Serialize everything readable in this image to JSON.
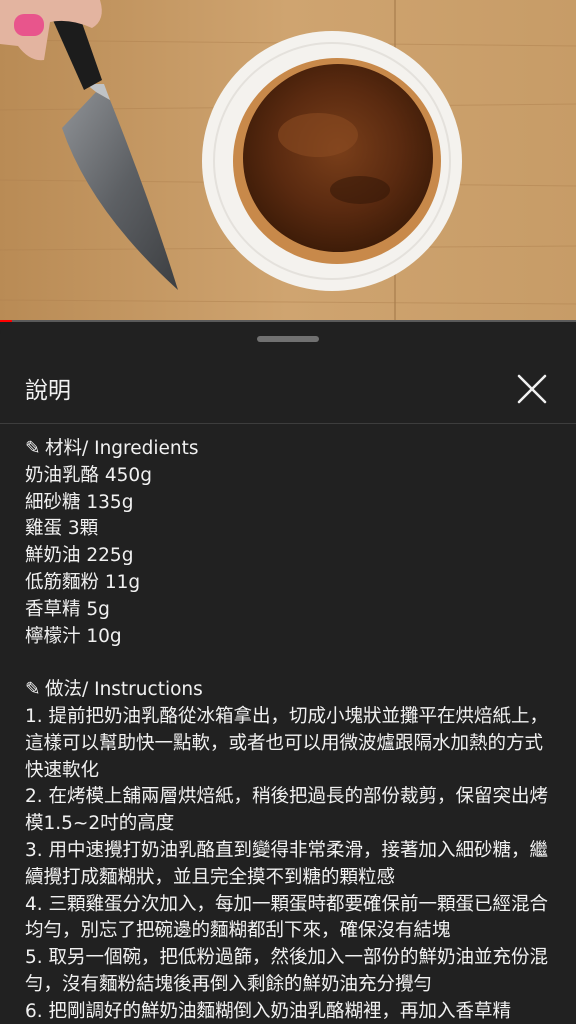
{
  "video": {
    "progress_fraction": 0.02,
    "accent_color": "#ff0000"
  },
  "sheet": {
    "title": "說明",
    "close_icon": "close-icon"
  },
  "description": {
    "ingredients_heading_icon": "pencil-icon",
    "ingredients_heading": "材料/ Ingredients",
    "ingredients": [
      "奶油乳酪 450g",
      "細砂糖 135g",
      "雞蛋 3顆",
      "鮮奶油 225g",
      "低筋麵粉 11g",
      "香草精 5g",
      "檸檬汁 10g"
    ],
    "instructions_heading_icon": "pencil-icon",
    "instructions_heading": "做法/ Instructions",
    "steps": [
      "1. 提前把奶油乳酪從冰箱拿出，切成小塊狀並攤平在烘焙紙上，這樣可以幫助快一點軟，或者也可以用微波爐跟隔水加熱的方式快速軟化",
      "2. 在烤模上舖兩層烘焙紙，稍後把過長的部份裁剪，保留突出烤模1.5~2吋的高度",
      "3. 用中速攪打奶油乳酪直到變得非常柔滑，接著加入細砂糖，繼續攪打成麵糊狀，並且完全摸不到糖的顆粒感",
      "4. 三顆雞蛋分次加入，每加一顆蛋時都要確保前一顆蛋已經混合均勻，別忘了把碗邊的麵糊都刮下來，確保沒有結塊",
      "5. 取另一個碗，把低粉過篩，然後加入一部份的鮮奶油並充份混勻，沒有麵粉結塊後再倒入剩餘的鮮奶油充分攪勻",
      "6. 把剛調好的鮮奶油麵糊倒入奶油乳酪糊裡，再加入香草精"
    ]
  }
}
